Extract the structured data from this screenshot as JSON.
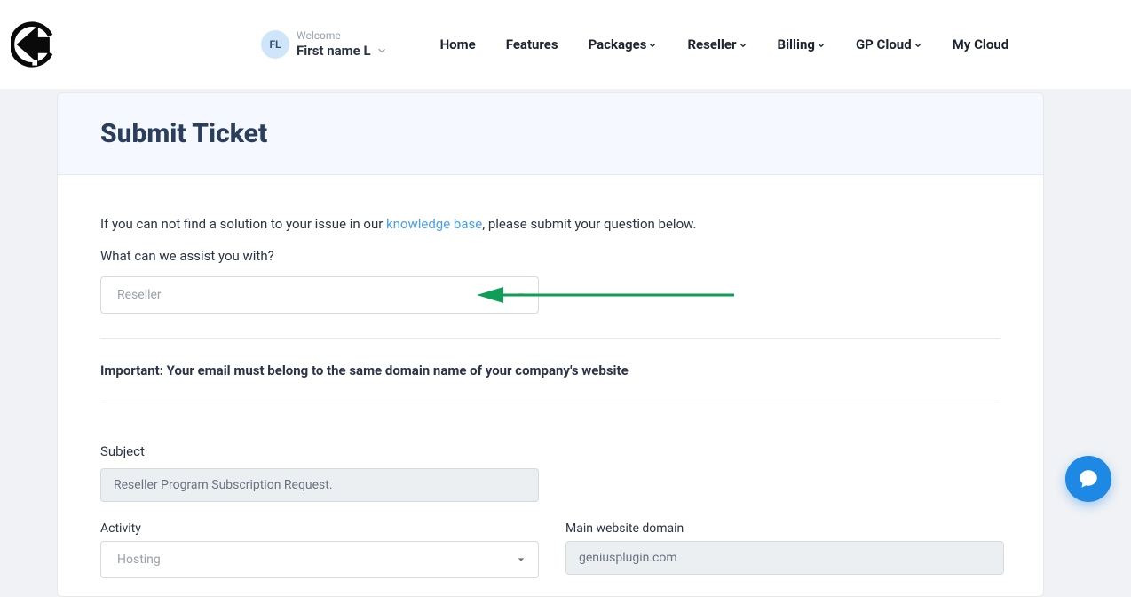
{
  "header": {
    "avatar_initials": "FL",
    "welcome_label": "Welcome",
    "user_name": "First name L",
    "nav": {
      "home": "Home",
      "features": "Features",
      "packages": "Packages",
      "reseller": "Reseller",
      "billing": "Billing",
      "gp_cloud": "GP Cloud",
      "my_cloud": "My Cloud"
    }
  },
  "page": {
    "title": "Submit Ticket",
    "intro_before": "If you can not find a solution to your issue in our ",
    "intro_link": "knowledge base",
    "intro_after": ", please submit your question below.",
    "assist_label": "What can we assist you with?",
    "assist_value": "Reseller",
    "important_note": "Important: Your email must belong to the same domain name of your company's website",
    "subject_label": "Subject",
    "subject_value": "Reseller Program Subscription Request.",
    "activity_label": "Activity",
    "activity_value": "Hosting",
    "domain_label": "Main website domain",
    "domain_value": "geniusplugin.com"
  }
}
